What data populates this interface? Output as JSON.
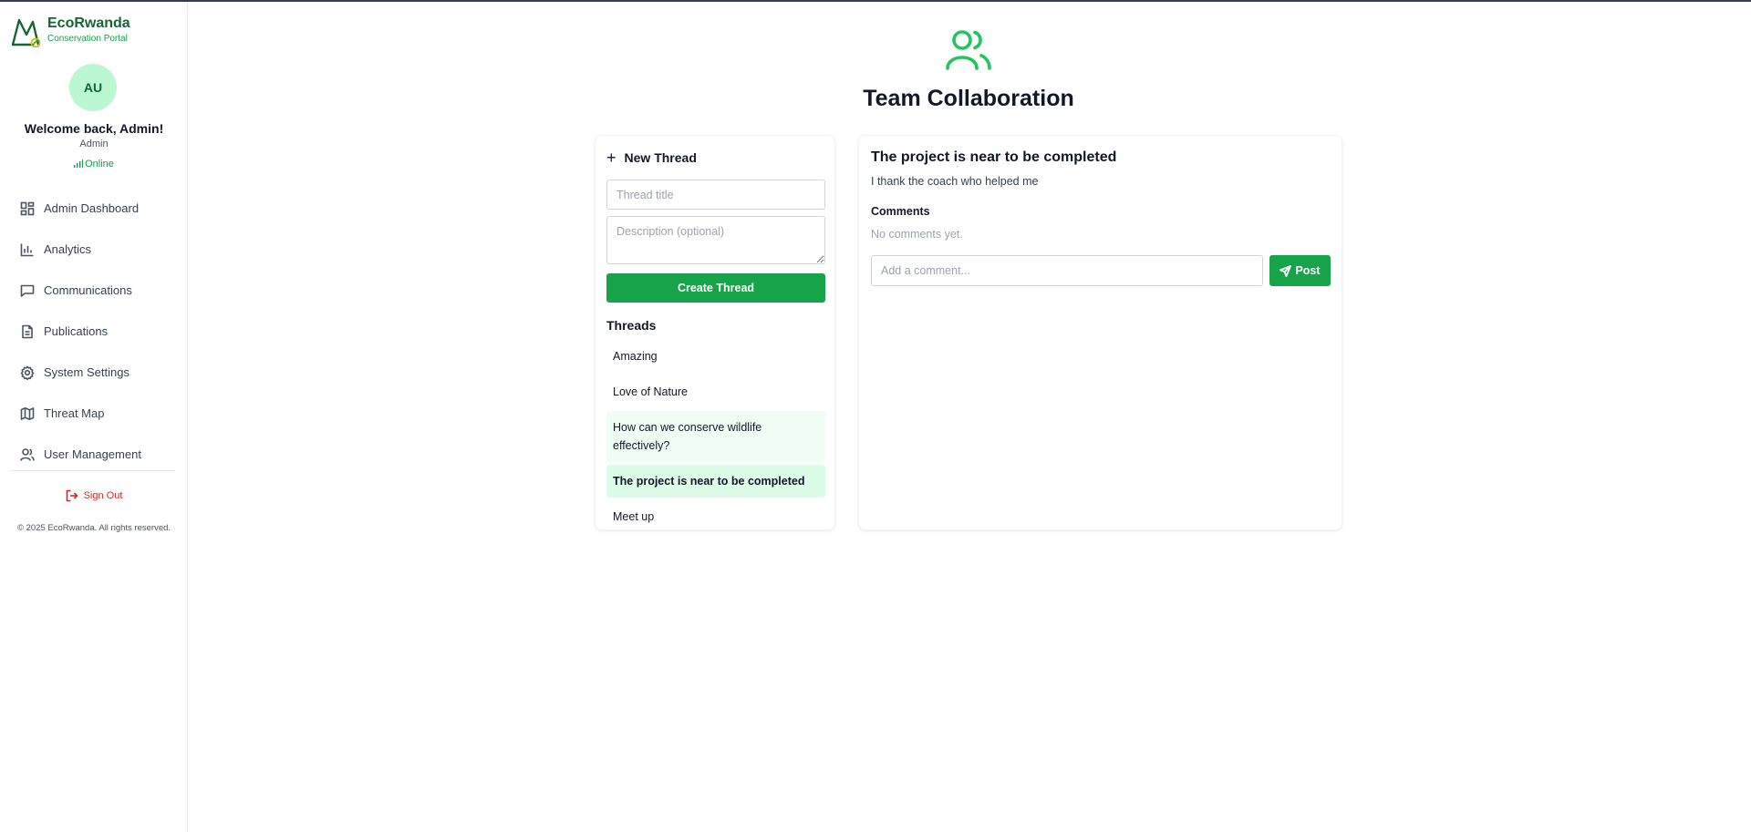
{
  "brand": {
    "name": "EcoRwanda",
    "subtitle": "Conservation Portal",
    "logo_icon": "mountain-logo-icon"
  },
  "user": {
    "initials": "AU",
    "welcome": "Welcome back, Admin!",
    "role": "Admin",
    "status": "Online"
  },
  "nav": {
    "items": [
      {
        "label": "Admin Dashboard",
        "icon": "dashboard-icon"
      },
      {
        "label": "Analytics",
        "icon": "bar-chart-icon"
      },
      {
        "label": "Communications",
        "icon": "message-icon"
      },
      {
        "label": "Publications",
        "icon": "document-icon"
      },
      {
        "label": "System Settings",
        "icon": "gear-icon"
      },
      {
        "label": "Threat Map",
        "icon": "map-icon"
      },
      {
        "label": "User Management",
        "icon": "users-icon"
      }
    ],
    "signout": "Sign Out"
  },
  "footer": {
    "copyright": "© 2025 EcoRwanda. All rights reserved."
  },
  "page": {
    "title": "Team Collaboration",
    "icon": "users-icon"
  },
  "new_thread": {
    "header": "New Thread",
    "title_placeholder": "Thread title",
    "title_value": "",
    "description_placeholder": "Description (optional)",
    "description_value": "",
    "create_label": "Create Thread"
  },
  "threads": {
    "label": "Threads",
    "items": [
      {
        "title": "Amazing"
      },
      {
        "title": "Love of Nature"
      },
      {
        "title": "How can we conserve wildlife effectively?"
      },
      {
        "title": "The project is near to be completed"
      },
      {
        "title": "Meet up"
      }
    ]
  },
  "selected_thread": {
    "title": "The project is near to be completed",
    "description": "I thank the coach who helped me",
    "comments_label": "Comments",
    "no_comments": "No comments yet.",
    "comment_placeholder": "Add a comment...",
    "comment_value": "",
    "post_label": "Post"
  },
  "colors": {
    "accent": "#16a34a",
    "brand_dark": "#166534",
    "avatar_bg": "#bbf7d0",
    "danger": "#dc2626",
    "thread_hover": "#f0fdf4",
    "thread_active": "#dcfce7"
  }
}
